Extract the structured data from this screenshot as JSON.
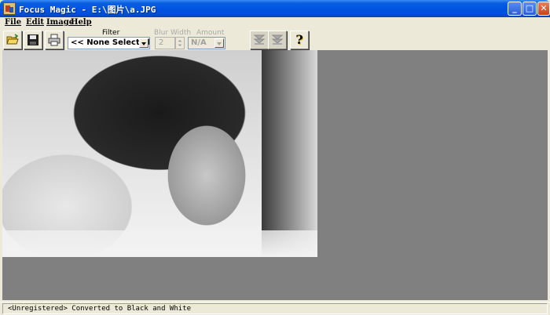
{
  "window": {
    "title": "Focus Magic - E:\\图片\\a.JPG",
    "controls": {
      "minimize": "_",
      "maximize": "□",
      "close": "✕"
    }
  },
  "menu": {
    "items": [
      {
        "label": "File"
      },
      {
        "label": "Edit"
      },
      {
        "label": "Image"
      },
      {
        "label": "Help"
      }
    ]
  },
  "toolbar": {
    "buttons": [
      {
        "icon": "open-folder-icon"
      },
      {
        "icon": "save-disk-icon"
      },
      {
        "icon": "printer-icon"
      },
      {
        "icon": "focus-down-icon"
      },
      {
        "icon": "focus-down-icon"
      },
      {
        "icon": "help-question-icon"
      }
    ],
    "filter": {
      "label": "Filter",
      "selected": "<< None Selected >>"
    },
    "blur_width": {
      "label": "Blur Width",
      "value": "2"
    },
    "amount": {
      "label": "Amount",
      "selected": "N/A"
    },
    "help_glyph": "?"
  },
  "status": {
    "text": "<Unregistered>  Converted to Black and White"
  },
  "colors": {
    "titlebar": "#0053e1",
    "chrome": "#ECE9D8",
    "workspace": "#808080"
  }
}
